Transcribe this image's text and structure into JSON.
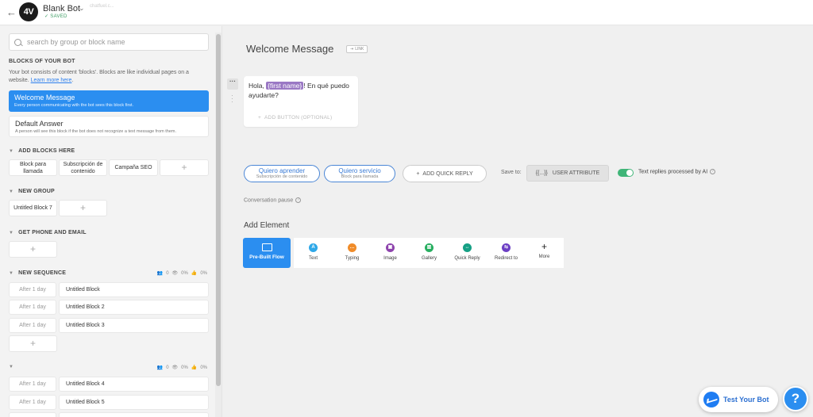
{
  "header": {
    "back_icon": "arrow-left-icon",
    "logo_text": "4V",
    "bot_name": "Blank Bot",
    "status": "SAVED",
    "bot_id": "chatfuel.c..."
  },
  "sidebar": {
    "search_placeholder": "search by group or block name",
    "blocks_title": "BLOCKS OF YOUR BOT",
    "blocks_desc": "Your bot consists of content 'blocks'. Blocks are like individual pages on a website.",
    "learn_more": "Learn more here",
    "welcome": {
      "title": "Welcome Message",
      "subtitle": "Every person communicating with the bot sees this block first."
    },
    "default_answer": {
      "title": "Default Answer",
      "subtitle": "A person will see this block if the bot does not recognize a text message from them."
    },
    "groups": [
      {
        "title": "ADD BLOCKS HERE",
        "blocks": [
          "Block para llamada",
          "Subscripción de contenido",
          "Campaña SEO"
        ]
      },
      {
        "title": "NEW GROUP",
        "blocks": [
          "Untitled Block 7"
        ]
      },
      {
        "title": "GET PHONE AND EMAIL",
        "blocks": []
      }
    ],
    "sequence": {
      "title": "NEW SEQUENCE",
      "stats": {
        "users": "0",
        "views": "0%",
        "likes": "0%"
      },
      "rows": [
        {
          "delay": "After 1 day",
          "name": "Untitled Block"
        },
        {
          "delay": "After 1 day",
          "name": "Untitled Block 2"
        },
        {
          "delay": "After 1 day",
          "name": "Untitled Block 3"
        }
      ]
    },
    "sequence2": {
      "stats": {
        "users": "0",
        "views": "0%",
        "likes": "0%"
      },
      "rows": [
        {
          "delay": "After 1 day",
          "name": "Untitled Block 4"
        },
        {
          "delay": "After 1 day",
          "name": "Untitled Block 5"
        }
      ]
    }
  },
  "main": {
    "title": "Welcome Message",
    "link_label": "LINK",
    "message_before": "Hola, ",
    "message_tag": "{first name}",
    "message_after": "! En qué puedo ayudarte?",
    "add_button": "ADD BUTTON (OPTIONAL)",
    "quick_replies": [
      {
        "label": "Quiero aprender",
        "target": "Subscripción de contenido"
      },
      {
        "label": "Quiero servicio",
        "target": "Block para llamada"
      }
    ],
    "add_quick_reply": "ADD QUICK REPLY",
    "save_to": "Save to:",
    "user_attribute": "USER ATTRIBUTE",
    "user_attribute_icon": "{{...}}",
    "ai_toggle_label": "Text replies processed by AI",
    "conversation_pause": "Conversation pause",
    "add_element": "Add Element",
    "prebuilt_flow": "Pre-Built Flow",
    "elements": [
      {
        "label": "Text",
        "icon": "A",
        "color": "#2fa8e8"
      },
      {
        "label": "Typing",
        "icon": "…",
        "color": "#f08c2a"
      },
      {
        "label": "Image",
        "icon": "▣",
        "color": "#8e44ad"
      },
      {
        "label": "Gallery",
        "icon": "▥",
        "color": "#27ae60"
      },
      {
        "label": "Quick Reply",
        "icon": "↔",
        "color": "#16a085"
      },
      {
        "label": "Redirect to",
        "icon": "⇆",
        "color": "#6c3fc4"
      },
      {
        "label": "More",
        "icon": "+",
        "color": ""
      }
    ],
    "test_bot": "Test Your Bot",
    "help": "?"
  }
}
